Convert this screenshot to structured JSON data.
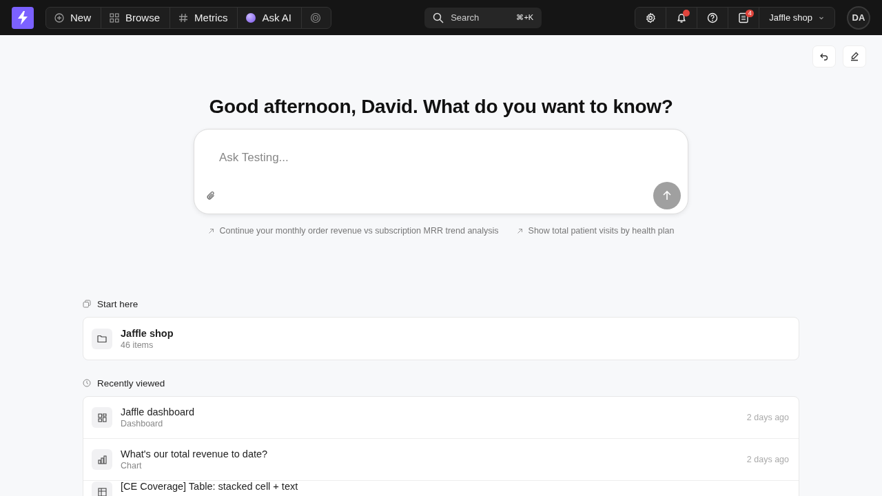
{
  "nav": {
    "items": [
      {
        "kind": "new",
        "label": "New"
      },
      {
        "kind": "browse",
        "label": "Browse"
      },
      {
        "kind": "metrics",
        "label": "Metrics"
      },
      {
        "kind": "ai",
        "label": "Ask AI"
      },
      {
        "kind": "target"
      }
    ]
  },
  "search": {
    "placeholder": "Search",
    "shortcut": "⌘+K"
  },
  "toolbar": {
    "notifications_unread": true,
    "docs_badge": "4",
    "workspace": "Jaffle shop"
  },
  "avatar": "DA",
  "greeting": "Good afternoon, David. What do you want to know?",
  "ask": {
    "placeholder": "Ask Testing..."
  },
  "suggestions": [
    "Continue your monthly order revenue vs subscription MRR trend analysis",
    "Show total patient visits by health plan"
  ],
  "start_here": {
    "title": "Start here",
    "items": [
      {
        "name": "Jaffle shop",
        "meta": "46 items"
      }
    ]
  },
  "recent": {
    "title": "Recently viewed",
    "items": [
      {
        "kind": "dashboard",
        "name": "Jaffle dashboard",
        "type": "Dashboard",
        "time": "2 days ago"
      },
      {
        "kind": "chart",
        "name": "What's our total revenue to date?",
        "type": "Chart",
        "time": "2 days ago"
      },
      {
        "kind": "table",
        "name": "[CE Coverage] Table: stacked cell + text"
      }
    ]
  }
}
